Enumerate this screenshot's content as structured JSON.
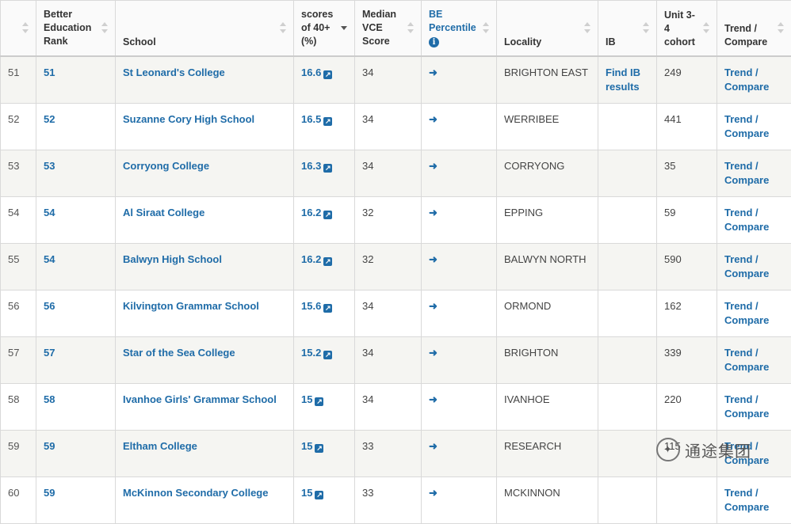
{
  "headers": {
    "index": "",
    "rank": "Better Education Rank",
    "school": "School",
    "scores40": "scores of 40+ (%)",
    "median": "Median VCE Score",
    "be_percentile": "BE Percentile",
    "locality": "Locality",
    "ib": "IB",
    "cohort": "Unit 3-4 cohort",
    "trend": "Trend / Compare"
  },
  "icons": {
    "external": "external-link-icon",
    "enter": "sign-in-icon",
    "info": "info-circle-icon",
    "sort": "sort-icon"
  },
  "rows": [
    {
      "index": "51",
      "rank": "51",
      "school": "St Leonard's College",
      "score": "16.6",
      "median": "34",
      "locality": "BRIGHTON EAST",
      "ib": "Find IB results",
      "cohort": "249",
      "trend": "Trend / Compare"
    },
    {
      "index": "52",
      "rank": "52",
      "school": "Suzanne Cory High School",
      "score": "16.5",
      "median": "34",
      "locality": "WERRIBEE",
      "ib": "",
      "cohort": "441",
      "trend": "Trend / Compare"
    },
    {
      "index": "53",
      "rank": "53",
      "school": "Corryong College",
      "score": "16.3",
      "median": "34",
      "locality": "CORRYONG",
      "ib": "",
      "cohort": "35",
      "trend": "Trend / Compare"
    },
    {
      "index": "54",
      "rank": "54",
      "school": "Al Siraat College",
      "score": "16.2",
      "median": "32",
      "locality": "EPPING",
      "ib": "",
      "cohort": "59",
      "trend": "Trend / Compare"
    },
    {
      "index": "55",
      "rank": "54",
      "school": "Balwyn High School",
      "score": "16.2",
      "median": "32",
      "locality": "BALWYN NORTH",
      "ib": "",
      "cohort": "590",
      "trend": "Trend / Compare"
    },
    {
      "index": "56",
      "rank": "56",
      "school": "Kilvington Grammar School",
      "score": "15.6",
      "median": "34",
      "locality": "ORMOND",
      "ib": "",
      "cohort": "162",
      "trend": "Trend / Compare"
    },
    {
      "index": "57",
      "rank": "57",
      "school": "Star of the Sea College",
      "score": "15.2",
      "median": "34",
      "locality": "BRIGHTON",
      "ib": "",
      "cohort": "339",
      "trend": "Trend / Compare"
    },
    {
      "index": "58",
      "rank": "58",
      "school": "Ivanhoe Girls' Grammar School",
      "score": "15",
      "median": "34",
      "locality": "IVANHOE",
      "ib": "",
      "cohort": "220",
      "trend": "Trend / Compare"
    },
    {
      "index": "59",
      "rank": "59",
      "school": "Eltham College",
      "score": "15",
      "median": "33",
      "locality": "RESEARCH",
      "ib": "",
      "cohort": "115",
      "trend": "Trend / Compare"
    },
    {
      "index": "60",
      "rank": "59",
      "school": "McKinnon Secondary College",
      "score": "15",
      "median": "33",
      "locality": "MCKINNON",
      "ib": "",
      "cohort": "",
      "trend": "Trend / Compare"
    }
  ],
  "watermark": {
    "text": "通途集团"
  },
  "colors": {
    "link": "#1f6ca8",
    "stripe": "#f5f5f2",
    "border": "#d9d9d9"
  }
}
